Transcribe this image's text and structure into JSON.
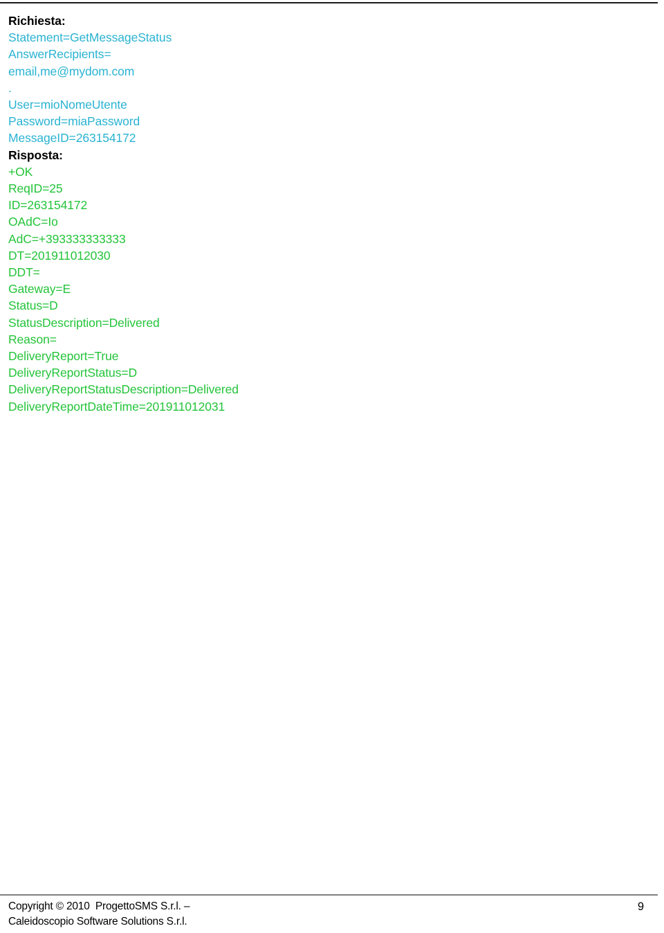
{
  "document": {
    "page_number": "9",
    "colors": {
      "request_text": "#2ab3d2",
      "response_text": "#24c43a",
      "label_text": "#000000",
      "header_rule": "#1a1a1a",
      "footer_rule": "#808080",
      "background": "#ffffff"
    }
  },
  "request": {
    "label": "Richiesta:",
    "lines": [
      "Statement=GetMessageStatus",
      "AnswerRecipients=",
      "email,me@mydom.com",
      ".",
      "User=mioNomeUtente",
      "Password=miaPassword",
      "MessageID=263154172"
    ]
  },
  "response": {
    "label": "Risposta:",
    "lines": [
      "+OK",
      "ReqID=25",
      "ID=263154172",
      "OAdC=Io",
      "AdC=+393333333333",
      "DT=201911012030",
      "DDT=",
      "Gateway=E",
      "Status=D",
      "StatusDescription=Delivered",
      "Reason=",
      "DeliveryReport=True",
      "DeliveryReportStatus=D",
      "DeliveryReportStatusDescription=Delivered",
      "DeliveryReportDateTime=201911012031"
    ]
  },
  "footer": {
    "copyright_line_1": "Copyright © 2010  ProgettoSMS S.r.l. –",
    "copyright_line_2": "Caleidoscopio Software Solutions S.r.l.",
    "page_number": "9"
  }
}
